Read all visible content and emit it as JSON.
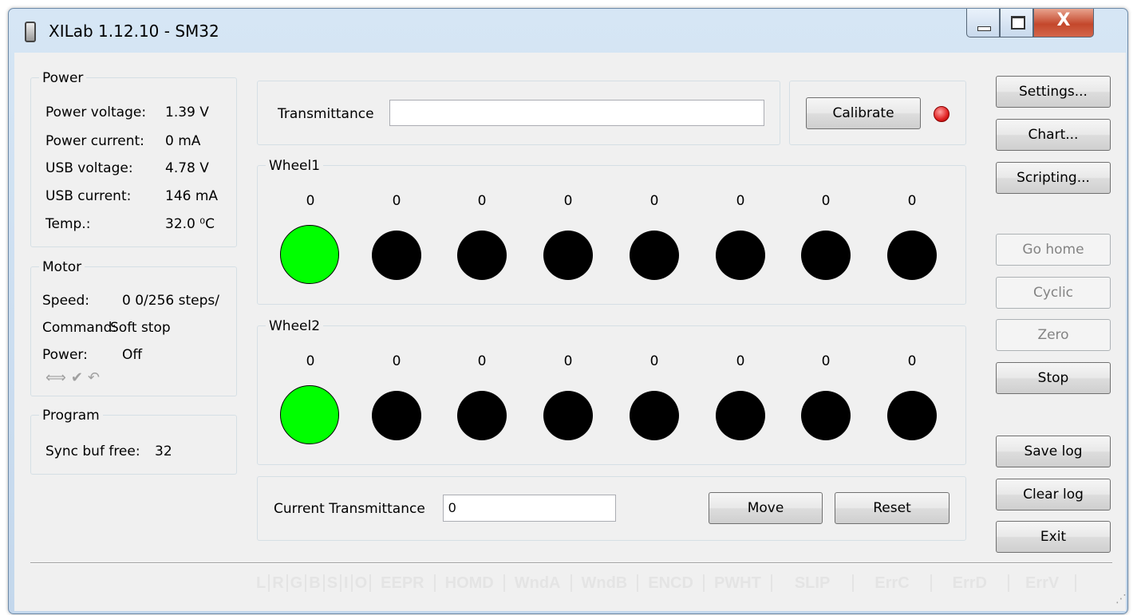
{
  "window": {
    "title": "XILab 1.12.10 - SM32",
    "close_glyph": "X"
  },
  "power": {
    "title": "Power",
    "rows": [
      {
        "label": "Power voltage:",
        "value": "1.39 V"
      },
      {
        "label": "Power current:",
        "value": "0 mA"
      },
      {
        "label": "USB voltage:",
        "value": "4.78 V"
      },
      {
        "label": "USB current:",
        "value": "146 mA"
      },
      {
        "label": "Temp.:",
        "value": "32.0 ⁰C"
      }
    ]
  },
  "motor": {
    "title": "Motor",
    "speed_label": "Speed:",
    "speed_value": "0 0/256 steps/",
    "command_label": "Command:",
    "command_value": "Soft stop",
    "power_label": "Power:",
    "power_value": "Off",
    "icons": [
      "double-arrow-icon",
      "checkmark-icon",
      "undo-icon"
    ]
  },
  "program": {
    "title": "Program",
    "sync_label": "Sync buf free:",
    "sync_value": "32"
  },
  "transmittance": {
    "label": "Transmittance",
    "value": ""
  },
  "calibrate": {
    "label": "Calibrate",
    "led_color": "#e02020"
  },
  "wheel1": {
    "title": "Wheel1",
    "counts": [
      "0",
      "0",
      "0",
      "0",
      "0",
      "0",
      "0",
      "0"
    ],
    "active_index": 0
  },
  "wheel2": {
    "title": "Wheel2",
    "counts": [
      "0",
      "0",
      "0",
      "0",
      "0",
      "0",
      "0",
      "0"
    ],
    "active_index": 0
  },
  "current": {
    "label": "Current Transmittance",
    "value": "0",
    "move_label": "Move",
    "reset_label": "Reset"
  },
  "right_buttons": {
    "settings": "Settings...",
    "chart": "Chart...",
    "scripting": "Scripting...",
    "go_home": "Go home",
    "cyclic": "Cyclic",
    "zero": "Zero",
    "stop": "Stop",
    "save_log": "Save log",
    "clear_log": "Clear log",
    "exit": "Exit"
  },
  "status_flags": [
    "L",
    "R",
    "G",
    "B",
    "S",
    "I",
    "O",
    "EEPR",
    "HOMD",
    "WndA",
    "WndB",
    "ENCD",
    "PWHT",
    "SLIP",
    "ErrC",
    "ErrD",
    "ErrV"
  ],
  "colors": {
    "active_position": "#00ff00",
    "inactive_position": "#000000"
  }
}
